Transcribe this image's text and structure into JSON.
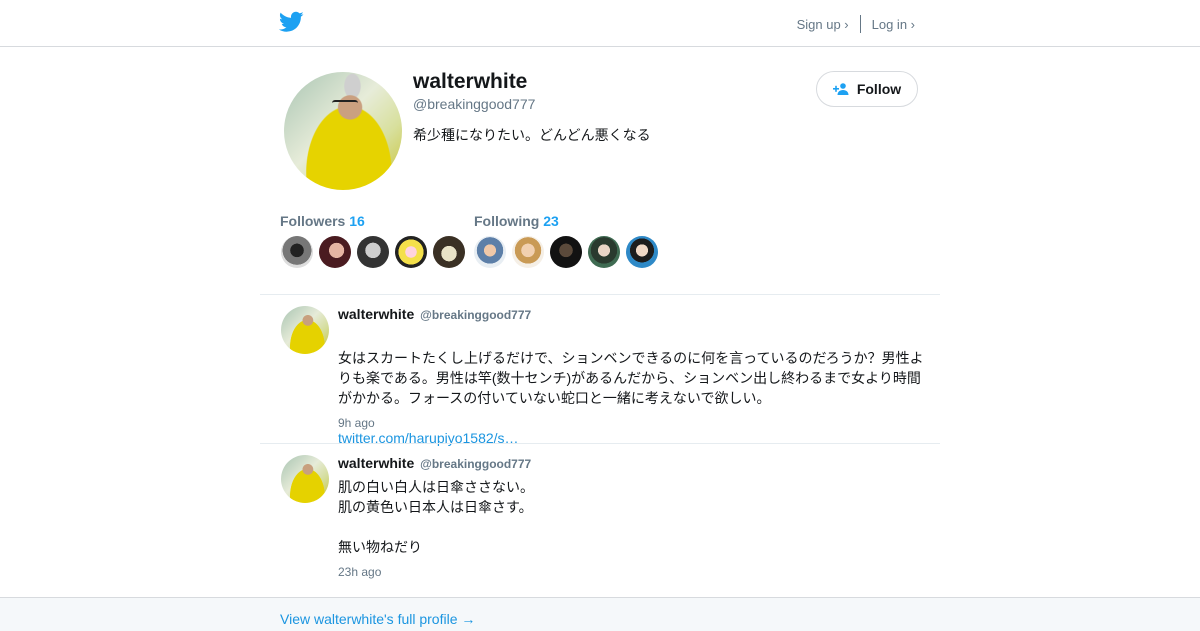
{
  "header": {
    "signup_label": "Sign up ›",
    "login_label": "Log in ›"
  },
  "profile": {
    "name": "walterwhite",
    "handle": "@breakinggood777",
    "bio": "希少種になりたい。どんどん悪くなる",
    "follow_label": "Follow",
    "followers_label": "Followers",
    "followers_count": "16",
    "following_label": "Following",
    "following_count": "23"
  },
  "tweets": [
    {
      "name": "walterwhite",
      "handle": "@breakinggood777",
      "text": "女はスカートたくし上げるだけで、ションベンできるのに何を言っているのだろうか？男性よりも楽である。男性は竿(数十センチ)があるんだから、ションベン出し終わるまで女より時間がかかる。フォースの付いていない蛇口と一緒に考えないで欲しい。",
      "link": "twitter.com/harupiyo1582/s…",
      "time": "9h ago"
    },
    {
      "name": "walterwhite",
      "handle": "@breakinggood777",
      "text": "肌の白い白人は日傘ささない。\n肌の黄色い日本人は日傘さす。\n\n無い物ねだり",
      "time": "23h ago"
    }
  ],
  "footer": {
    "full_profile_link": "View walterwhite's full profile →"
  },
  "colors": {
    "accent": "#1da1f2",
    "link": "#1b95e0",
    "muted": "#657786"
  }
}
